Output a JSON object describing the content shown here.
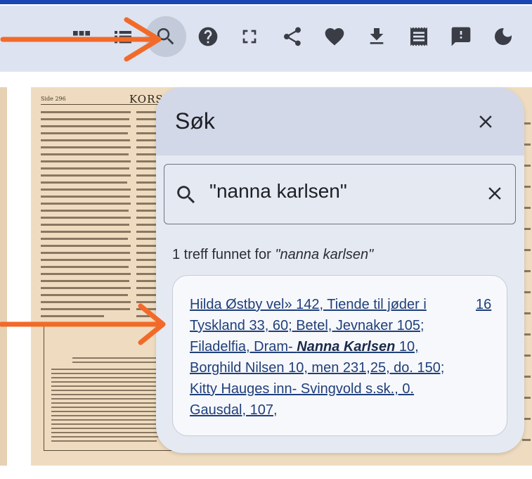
{
  "toolbar": {
    "buttons": [
      {
        "name": "grid-view-icon"
      },
      {
        "name": "list-view-icon"
      },
      {
        "name": "search-icon",
        "active": true
      },
      {
        "name": "help-icon"
      },
      {
        "name": "fullscreen-icon"
      },
      {
        "name": "share-icon"
      },
      {
        "name": "heart-icon"
      },
      {
        "name": "download-icon"
      },
      {
        "name": "receipt-icon"
      },
      {
        "name": "feedback-icon"
      },
      {
        "name": "dark-mode-icon"
      }
    ]
  },
  "page": {
    "header_left": "Side 296",
    "title": "KORSE"
  },
  "search_dialog": {
    "title": "Søk",
    "query": "\"nanna karlsen\"",
    "result_count_prefix": "1 treff funnet for ",
    "result_count_query": "\"nanna karlsen\"",
    "result": {
      "snippet_part1": "Hilda Østby vel» 142, Tiende til jøder i Tyskland 33, 60; Betel, Jevnaker 105; Filadelfia, Dram- ",
      "snippet_highlight": "Nanna Karlsen",
      "snippet_part2": " 10, Borghild Nilsen 10, men 231,25, do. 150; Kitty Hauges inn- Svingvold s.sk., 0. Gausdal, 107,",
      "page": "16"
    }
  },
  "colors": {
    "accent": "#1a45b4",
    "toolbar_bg": "#dde3f0",
    "arrow": "#f26a2a",
    "link": "#1f3f7a"
  }
}
